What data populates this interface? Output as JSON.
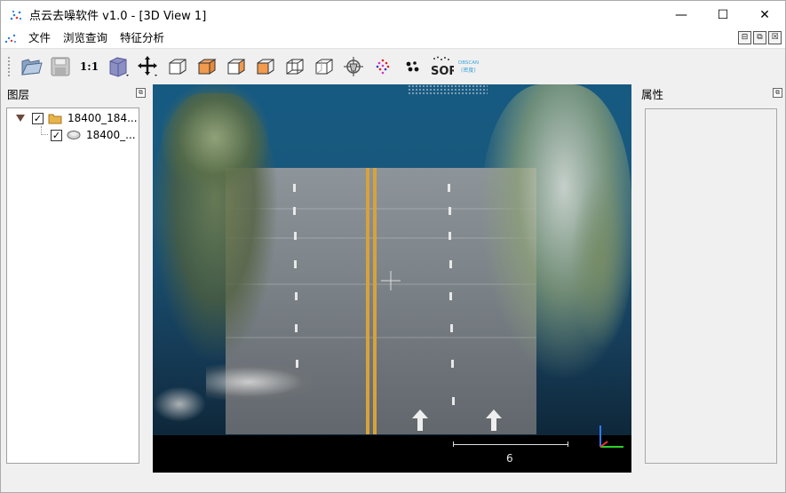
{
  "window": {
    "title": "点云去噪软件 v1.0 - [3D View 1]",
    "minimize_glyph": "—",
    "maximize_glyph": "☐",
    "close_glyph": "✕"
  },
  "menu": {
    "items": [
      {
        "label": "文件"
      },
      {
        "label": "浏览查询"
      },
      {
        "label": "特征分析"
      }
    ],
    "mdi_buttons": [
      "⊟",
      "⧉",
      "☒"
    ]
  },
  "toolbar": {
    "one_to_one_label": "1:1",
    "sor_label": "SOR",
    "dbscan_label": "DBSCAN",
    "dbscan_sub_label": "(密度)",
    "buttons": [
      "open-folder-icon",
      "save-icon",
      "zoom-1to1",
      "cube-view-icon",
      "pan-move-icon",
      "view-front-icon",
      "view-top-icon",
      "view-left-icon",
      "view-right-icon",
      "view-back-icon",
      "view-bottom-icon",
      "pick-point-icon",
      "random-points-icon",
      "dots-cluster-icon",
      "sor-filter-icon",
      "dbscan-filter-icon"
    ]
  },
  "layers_panel": {
    "title": "图层",
    "float_glyph": "⧉",
    "items": [
      {
        "label": "18400_184...",
        "checked": true,
        "check_glyph": "✓",
        "icon": "folder-icon"
      },
      {
        "label": "18400_...",
        "checked": true,
        "check_glyph": "✓",
        "icon": "point-cloud-icon"
      }
    ]
  },
  "properties_panel": {
    "title": "属性",
    "float_glyph": "⧉"
  },
  "viewport": {
    "scale_label": "6"
  },
  "colors": {
    "accent": "#0078d7",
    "sky_top": "#165a82",
    "road": "#7d8489",
    "lane_yellow": "#d8a23a"
  }
}
